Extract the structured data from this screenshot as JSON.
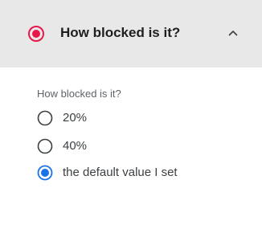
{
  "header": {
    "title": "How blocked is it?",
    "status_icon": "radio-active-icon",
    "toggle_icon": "chevron-up-icon",
    "accent_color": "#e8184a",
    "background": "#e8e8e8"
  },
  "question": {
    "label": "How blocked is it?",
    "options": [
      {
        "label": "20%",
        "selected": false
      },
      {
        "label": "40%",
        "selected": false
      },
      {
        "label": "the default value I set",
        "selected": true
      }
    ],
    "selected_color": "#1a73e8",
    "unselected_color": "#5f6368"
  }
}
